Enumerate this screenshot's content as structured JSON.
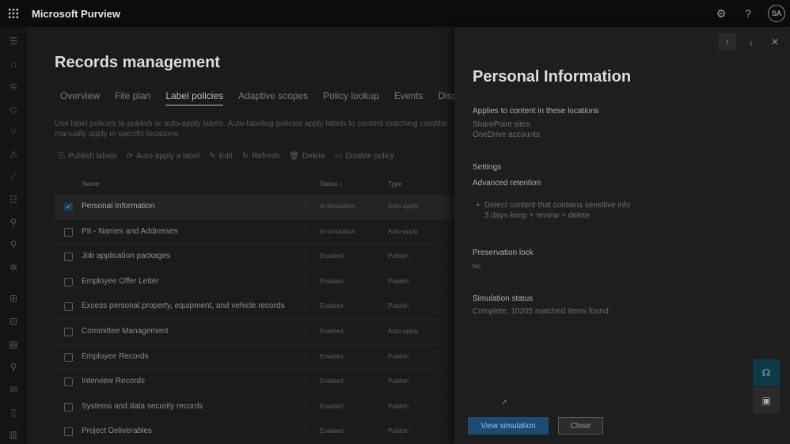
{
  "topbar": {
    "app_title": "Microsoft Purview",
    "avatar_initials": "SA",
    "icons": [
      "waffle-icon",
      "settings-icon",
      "help-icon"
    ]
  },
  "rail": {
    "icons": [
      "hamburger-icon",
      "home-icon",
      "trophy-icon",
      "tag-icon",
      "branch-icon",
      "alert-icon",
      "chart-icon",
      "sliders-icon",
      "search-data-icon",
      "search-doc-icon",
      "gear-bug-icon",
      "solutions-icon",
      "catalog-icon",
      "report-icon",
      "search-icon",
      "mail-icon",
      "doc-icon",
      "building-icon"
    ]
  },
  "main": {
    "title": "Records management",
    "tabs": [
      {
        "label": "Overview",
        "active": false
      },
      {
        "label": "File plan",
        "active": false
      },
      {
        "label": "Label policies",
        "active": true
      },
      {
        "label": "Adaptive scopes",
        "active": false
      },
      {
        "label": "Policy lookup",
        "active": false
      },
      {
        "label": "Events",
        "active": false
      },
      {
        "label": "Disposit",
        "active": false
      }
    ],
    "description": "Use label policies to publish or auto-apply labels. Auto-labeling policies apply labels to content matching conditio manually apply in specific locations.",
    "toolbar": [
      {
        "label": "Publish labels",
        "icon": "publish-icon"
      },
      {
        "label": "Auto-apply a label",
        "icon": "auto-apply-icon"
      },
      {
        "label": "Edit",
        "icon": "edit-icon"
      },
      {
        "label": "Refresh",
        "icon": "refresh-icon"
      },
      {
        "label": "Delete",
        "icon": "delete-icon"
      },
      {
        "label": "Disable policy",
        "icon": "disable-icon"
      }
    ],
    "table": {
      "headers": {
        "name": "Name",
        "status": "Status ↓",
        "type": "Type"
      },
      "rows": [
        {
          "name": "Personal Information",
          "status": "In simulation",
          "type": "Auto-apply",
          "selected": true
        },
        {
          "name": "PII - Names and Addresses",
          "status": "In simulation",
          "type": "Auto-apply",
          "selected": false
        },
        {
          "name": "Job application packages",
          "status": "Enabled",
          "type": "Publish",
          "selected": false
        },
        {
          "name": "Employee Offer Letter",
          "status": "Enabled",
          "type": "Publish",
          "selected": false
        },
        {
          "name": "Excess personal property, equipment, and vehicle records",
          "status": "Enabled",
          "type": "Publish",
          "selected": false
        },
        {
          "name": "Committee Management",
          "status": "Enabled",
          "type": "Auto-apply",
          "selected": false
        },
        {
          "name": "Employee Records",
          "status": "Enabled",
          "type": "Publish",
          "selected": false
        },
        {
          "name": "Interview Records",
          "status": "Enabled",
          "type": "Publish",
          "selected": false
        },
        {
          "name": "Systems and data security records",
          "status": "Enabled",
          "type": "Publish",
          "selected": false
        },
        {
          "name": "Project Deliverables",
          "status": "Enabled",
          "type": "Publish",
          "selected": false
        }
      ]
    }
  },
  "panel": {
    "title": "Personal Information",
    "locations_heading": "Applies to content in these locations",
    "locations": [
      "SharePoint sites",
      "OneDrive accounts"
    ],
    "settings_heading": "Settings",
    "advanced_heading": "Advanced retention",
    "bullet_line1": "Detect content that contains sensitive info",
    "bullet_line2": "3 days keep + review + delete",
    "lock_heading": "Preservation lock",
    "lock_value": "No",
    "sim_heading": "Simulation status",
    "sim_value": "Complete, 10205 matched items found",
    "primary_button": "View simulation",
    "secondary_button": "Close"
  },
  "colors": {
    "primary_button": "#1b4a74",
    "float_button": "#0d3a44"
  }
}
